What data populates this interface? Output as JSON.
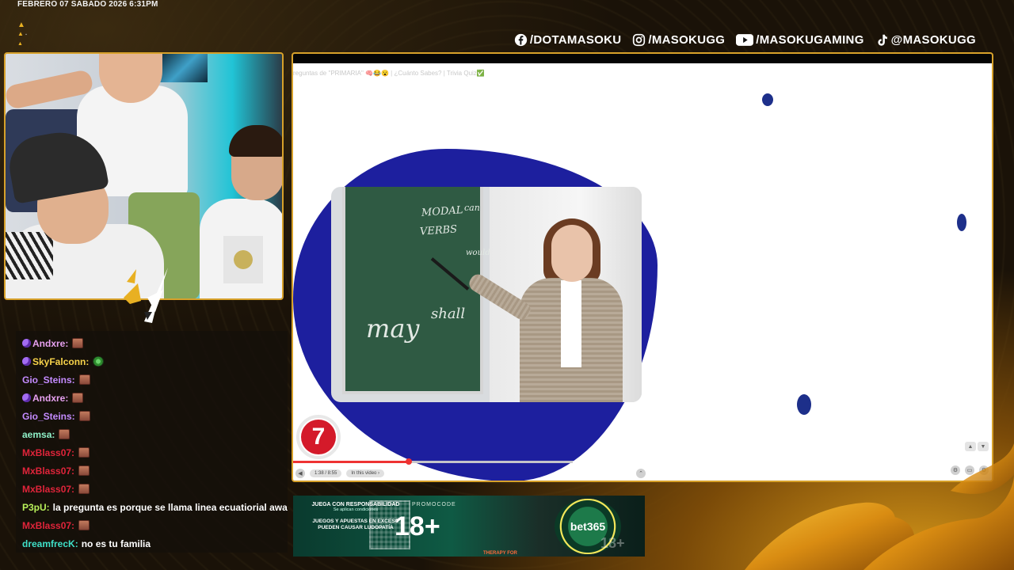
{
  "header": {
    "datetime": "FEBRERO 07 SABADO 2026 6:31PM"
  },
  "socials": [
    {
      "icon": "facebook-icon",
      "handle": "/DOTAMASOKU"
    },
    {
      "icon": "instagram-icon",
      "handle": "/MASOKUGG"
    },
    {
      "icon": "youtube-icon",
      "handle": "/MASOKUGAMING"
    },
    {
      "icon": "tiktok-icon",
      "handle": "@MASOKUGG"
    }
  ],
  "colors": {
    "accent": "#d7a12a",
    "video_blob": "#1d1f9e",
    "badge_red": "#d41a2a"
  },
  "chat": [
    {
      "user": "Andxre:",
      "color": "#e7a1f0",
      "badge": true,
      "message": "",
      "emotes": 1
    },
    {
      "user": "SkyFalconn:",
      "color": "#f7d34a",
      "badge": true,
      "message": "",
      "emotes": 1,
      "emote_type": "eye"
    },
    {
      "user": "Gio_Steins:",
      "color": "#c48bff",
      "badge": false,
      "message": "",
      "emotes": 1
    },
    {
      "user": "Andxre:",
      "color": "#e7a1f0",
      "badge": true,
      "message": "",
      "emotes": 1
    },
    {
      "user": "Gio_Steins:",
      "color": "#c48bff",
      "badge": false,
      "message": "",
      "emotes": 1
    },
    {
      "user": "aemsa:",
      "color": "#8ff0c8",
      "badge": false,
      "message": "",
      "emotes": 1
    },
    {
      "user": "MxBlass07:",
      "color": "#e0243a",
      "badge": false,
      "message": "",
      "emotes": 1
    },
    {
      "user": "MxBlass07:",
      "color": "#e0243a",
      "badge": false,
      "message": "",
      "emotes": 1
    },
    {
      "user": "MxBlass07:",
      "color": "#e0243a",
      "badge": false,
      "message": "",
      "emotes": 1
    },
    {
      "user": "P3pU:",
      "color": "#b8f05a",
      "badge": false,
      "message": "la pregunta es porque se llama linea ecuatiorial awa",
      "emotes": 0
    },
    {
      "user": "MxBlass07:",
      "color": "#e0243a",
      "badge": false,
      "message": "",
      "emotes": 1
    },
    {
      "user": "dreamfrecK:",
      "color": "#3fe0c8",
      "badge": false,
      "message": "no es tu familia",
      "emotes": 0
    }
  ],
  "video": {
    "title": "reguntas de \"PRIMARIA\" 🧠😂😮 | ¿Cuánto Sabes? | Trivia Quiz✅",
    "board_words": [
      "MODAL",
      "VERBS",
      "may",
      "shall",
      "can",
      "would"
    ],
    "question_number": "7",
    "time": "1:38 / 8:55",
    "in_video_label": "In this video",
    "progress": 0.17,
    "buffered": 0.41
  },
  "ad": {
    "responsibility": "JUEGA CON RESPONSABILIDAD",
    "conditions": "Se aplican condiciones",
    "warning": "JUEGOS Y APUESTAS EN EXCESO PUEDEN CAUSAR LUDOPATÍA",
    "promo_label": "PROMOCODE",
    "age": "18+",
    "brand": "bet365",
    "bottom_text": "THERAPY FOR"
  }
}
